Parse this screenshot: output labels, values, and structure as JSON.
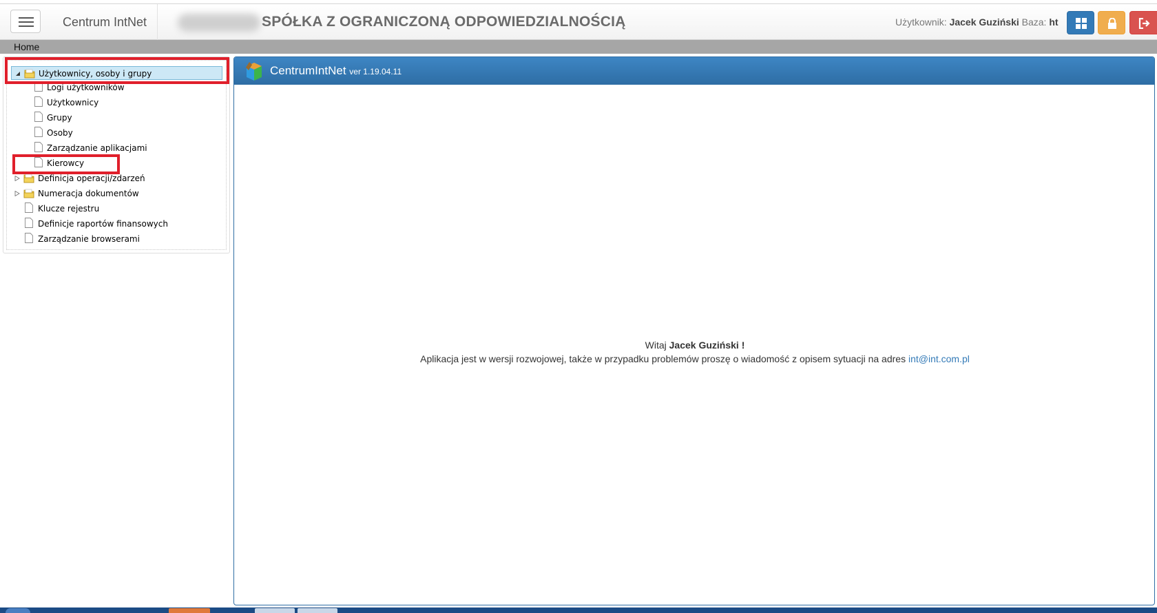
{
  "header": {
    "brand": "Centrum IntNet",
    "company_name": "SPÓŁKA Z OGRANICZONĄ ODPOWIEDZIALNOŚCIĄ",
    "user_label": "Użytkownik:",
    "user_name": "Jacek Guziński",
    "db_label": "Baza:",
    "db_value": "ht",
    "buttons": {
      "grid_icon": "grid-icon",
      "lock_icon": "lock-icon",
      "logout_icon": "logout-icon"
    }
  },
  "breadcrumb": {
    "home": "Home"
  },
  "tree": {
    "root_label": "Użytkownicy, osoby i grupy",
    "children": [
      "Logi użytkowników",
      "Użytkownicy",
      "Grupy",
      "Osoby",
      "Zarządzanie aplikacjami",
      "Kierowcy"
    ],
    "folders": [
      "Definicja operacji/zdarzeń",
      "Numeracja dokumentów"
    ],
    "leaves": [
      "Klucze rejestru",
      "Definicje raportów finansowych",
      "Zarządzanie browserami"
    ]
  },
  "content": {
    "app_name": "CentrumIntNet",
    "app_version": "ver 1.19.04.11",
    "welcome_prefix": "Witaj",
    "welcome_name": "Jacek Guziński !",
    "message": "Aplikacja jest w wersji rozwojowej, także w przypadku problemów proszę o wiadomość z opisem sytuacji na adres",
    "email": "int@int.com.pl"
  },
  "colors": {
    "primary": "#337ab7",
    "warning": "#f0ad4e",
    "danger": "#d9534f",
    "highlight": "#e01f2b",
    "selected_row": "#cde8f6"
  }
}
